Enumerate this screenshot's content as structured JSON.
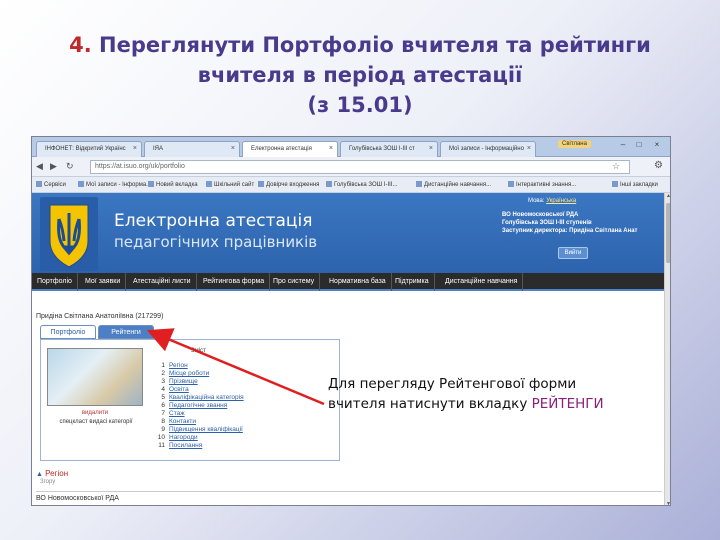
{
  "slide": {
    "title_num": "4.",
    "title_line1": "Переглянути Портфоліо вчителя та рейтинги",
    "title_line2": "вчителя в період атестації",
    "title_line3": "(з 15.01)"
  },
  "browser": {
    "tabs": [
      {
        "label": "ІНФОНЕТ: Відкритий Українс"
      },
      {
        "label": "ІЯА"
      },
      {
        "label": "Електронна атестація"
      },
      {
        "label": "Голубівська ЗОШ І-ІІІ ст"
      },
      {
        "label": "Мої записи - Інформаційно"
      }
    ],
    "user_label": "Світлана",
    "url": "https://at.isuo.org/uk/portfolio",
    "bookmarks": [
      "Сервіси",
      "Мої записи - Інформа...",
      "Новий вкладка",
      "Шкільний сайт",
      "Довірче входження",
      "Голубівська ЗОШ І-ІІІ...",
      "Дистанційне навчання...",
      "Інтерактивні знання..."
    ],
    "other_bookmarks": "Інші закладки"
  },
  "site": {
    "title_line1": "Електронна атестація",
    "title_line2": "педагогічних працівників",
    "login_prefix": "Мова:",
    "login_link": "Українська",
    "org_line1": "ВО Новомосковської РДА",
    "org_line2": "Голубівська ЗОШ І-ІІІ ступенів",
    "org_line3": "Заступник директора: Придіна Світлана Анат",
    "exit_label": "Вийти",
    "menu": [
      "Портфоліо",
      "Мої заявки",
      "Атестаційні листи",
      "Рейтингова форма",
      "Про систему",
      "Нормативна база",
      "Підтримка",
      "Дистанційне навчання"
    ],
    "teacher": "Придіна Світлана Анатоліївна (217299)",
    "tab_portfolio": "Портфоліо",
    "tab_rating": "Рейтенги",
    "photo_caption_1": "видалити",
    "photo_caption_2": "спецкласт видасі категорії",
    "list_head": "Зміст",
    "items": [
      {
        "n": "1",
        "t": "Регіон"
      },
      {
        "n": "2",
        "t": "Місце роботи"
      },
      {
        "n": "3",
        "t": "Прізвище"
      },
      {
        "n": "4",
        "t": "Освіта"
      },
      {
        "n": "5",
        "t": "Кваліфікаційна категорія"
      },
      {
        "n": "6",
        "t": "Педагогічне звання"
      },
      {
        "n": "7",
        "t": "Стаж"
      },
      {
        "n": "8",
        "t": "Контакти"
      },
      {
        "n": "9",
        "t": "Підвищення кваліфікації"
      },
      {
        "n": "10",
        "t": "Нагороди"
      },
      {
        "n": "11",
        "t": "Посилання"
      }
    ],
    "region_head": "Регіон",
    "region_sub": "Згору",
    "region_value": "ВО Новомосковської РДА"
  },
  "annotation": {
    "line1": "Для перегляду Рейтенгової форми",
    "line2_prefix": "вчителя натиснути вкладку ",
    "line2_highlight": "РЕЙТЕНГИ"
  },
  "colors": {
    "title": "#4a3a8c",
    "title_num": "#c0282a",
    "arrow": "#e02020",
    "annotation_highlight": "#8c1f7a",
    "site_header": "#3b77c2"
  }
}
